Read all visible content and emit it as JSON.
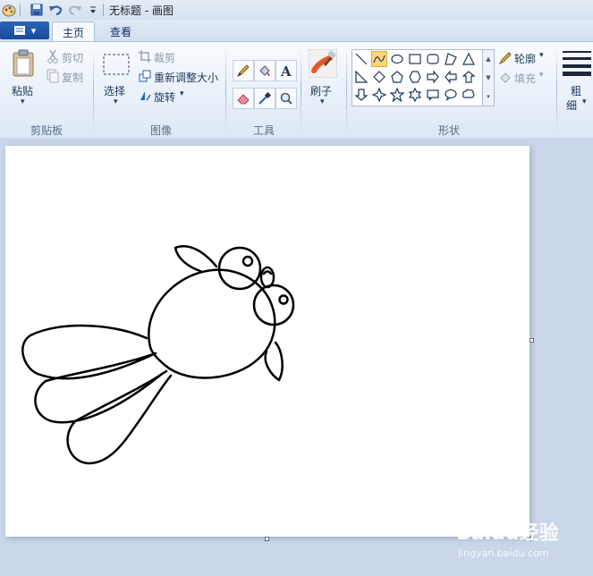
{
  "window": {
    "title": "无标题 - 画图"
  },
  "tabs": {
    "file_label": "▾",
    "home": "主页",
    "view": "查看"
  },
  "clipboard": {
    "paste": "粘贴",
    "cut": "剪切",
    "copy": "复制",
    "group": "剪贴板"
  },
  "image": {
    "select": "选择",
    "crop": "裁剪",
    "resize": "重新调整大小",
    "rotate": "旋转",
    "group": "图像"
  },
  "tools": {
    "group": "工具"
  },
  "brushes": {
    "label": "刷子"
  },
  "shapes": {
    "group": "形状",
    "outline": "轮廓",
    "fill": "填充"
  },
  "size": {
    "label_line1": "粗",
    "label_line2": "细"
  },
  "watermark": {
    "brand": "Baidu经验",
    "url": "jingyan.baidu.com"
  },
  "icons": [
    "paint-app-icon",
    "save-icon",
    "undo-icon",
    "redo-icon",
    "customize-icon",
    "paste-icon",
    "cut-icon",
    "copy-icon",
    "select-icon",
    "crop-icon",
    "resize-icon",
    "rotate-icon",
    "pencil-icon",
    "fill-icon",
    "text-icon",
    "eraser-icon",
    "color-picker-icon",
    "magnifier-icon",
    "brush-icon",
    "outline-icon",
    "fill-shape-icon",
    "size-lines-icon"
  ],
  "colors": {
    "accent": "#2b63b9",
    "selected_shape": "#ffd57a",
    "canvas": "#ffffff",
    "workspace": "#c9d7e8"
  }
}
